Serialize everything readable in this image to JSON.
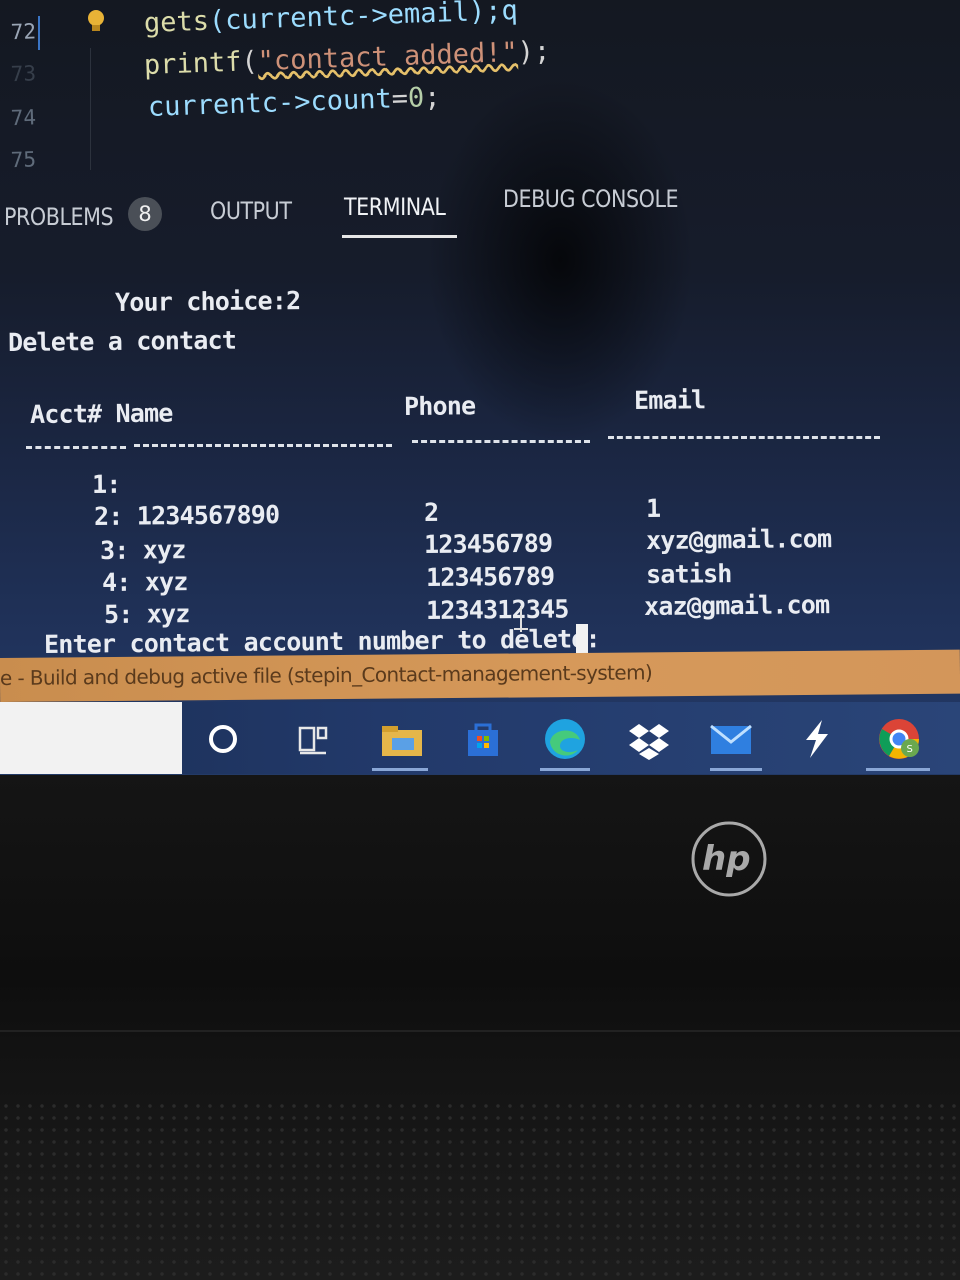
{
  "editor": {
    "line_numbers": [
      "72",
      "73",
      "74",
      "75"
    ],
    "lines": [
      {
        "fn": "gets",
        "rest": "(currentc->email);q"
      },
      {
        "fn": "printf",
        "str": "\"contact added!\"",
        "tail": ");"
      },
      {
        "id": "currentc->count",
        "op": "=",
        "num": "0",
        "tail": ";"
      }
    ]
  },
  "panel": {
    "tabs": [
      {
        "label": "PROBLEMS",
        "badge": "8"
      },
      {
        "label": "OUTPUT"
      },
      {
        "label": "TERMINAL",
        "active": true
      },
      {
        "label": "DEBUG CONSOLE"
      }
    ]
  },
  "terminal": {
    "choice_line": "Your choice:2",
    "action_line": "Delete a contact",
    "headers": {
      "acct_name": "Acct# Name",
      "phone": "Phone",
      "email": "Email"
    },
    "rows": [
      {
        "acct_name": "1:",
        "phone": "",
        "email": ""
      },
      {
        "acct_name": "2: 1234567890",
        "phone": "2",
        "email": "1"
      },
      {
        "acct_name": "3: xyz",
        "phone": "123456789",
        "email": "xyz@gmail.com"
      },
      {
        "acct_name": "4: xyz",
        "phone": "123456789",
        "email": "satish"
      },
      {
        "acct_name": "5: xyz",
        "phone": "1234312345",
        "email": "xaz@gmail.com"
      }
    ],
    "prompt": "Enter contact account number to delete: "
  },
  "status_bar": {
    "text": "e - Build and debug active file (stepin_Contact-management-system)"
  },
  "taskbar": {
    "icons": [
      "cortana-icon",
      "task-view-icon",
      "file-explorer-icon",
      "microsoft-store-icon",
      "edge-icon",
      "dropbox-icon",
      "mail-icon",
      "power-automate-icon",
      "chrome-icon"
    ],
    "colors": {
      "edge": "#1fa3e0",
      "store": "#2b6fd6",
      "mail": "#2f7fe0",
      "chrome_profile": "#6aa84f"
    }
  },
  "device": {
    "brand": "hp"
  }
}
